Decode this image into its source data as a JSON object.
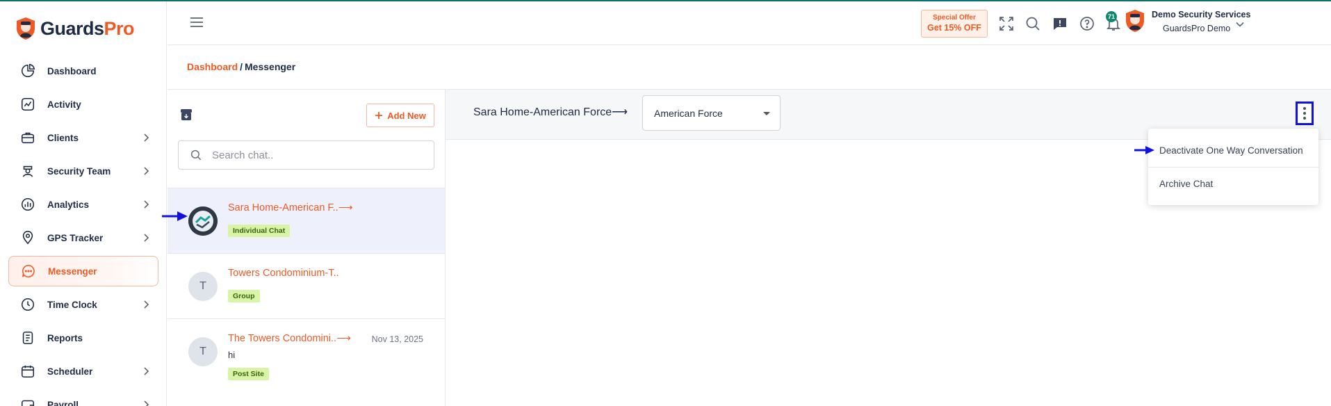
{
  "brand": {
    "name_part1": "Guards",
    "name_part2": "Pro"
  },
  "sidebar": {
    "items": [
      {
        "label": "Dashboard",
        "icon": "pie-chart-icon",
        "chevron": false,
        "active": false
      },
      {
        "label": "Activity",
        "icon": "activity-chart-icon",
        "chevron": false,
        "active": false
      },
      {
        "label": "Clients",
        "icon": "briefcase-icon",
        "chevron": true,
        "active": false
      },
      {
        "label": "Security Team",
        "icon": "guard-icon",
        "chevron": true,
        "active": false
      },
      {
        "label": "Analytics",
        "icon": "analytics-icon",
        "chevron": true,
        "active": false
      },
      {
        "label": "GPS Tracker",
        "icon": "location-pin-icon",
        "chevron": true,
        "active": false
      },
      {
        "label": "Messenger",
        "icon": "chat-bubble-icon",
        "chevron": false,
        "active": true
      },
      {
        "label": "Time Clock",
        "icon": "clock-icon",
        "chevron": true,
        "active": false
      },
      {
        "label": "Reports",
        "icon": "document-icon",
        "chevron": false,
        "active": false
      },
      {
        "label": "Scheduler",
        "icon": "calendar-icon",
        "chevron": true,
        "active": false
      },
      {
        "label": "Payroll",
        "icon": "wallet-icon",
        "chevron": true,
        "active": false
      }
    ]
  },
  "header": {
    "offer_line1": "Special Offer",
    "offer_line2": "Get 15% OFF",
    "notification_count": "71",
    "user_name": "Demo Security Services",
    "user_org": "GuardsPro Demo"
  },
  "breadcrumb": {
    "link": "Dashboard",
    "separator": "/",
    "current": "Messenger"
  },
  "chatlist": {
    "add_new_label": "Add New",
    "search_placeholder": "Search chat..",
    "chats": [
      {
        "name": "Sara Home-American F..⟶",
        "date": "",
        "message": "",
        "tag": "Individual Chat",
        "avatar_initial": "",
        "selected": true
      },
      {
        "name": "Towers Condominium-T..",
        "date": "",
        "message": "",
        "tag": "Group",
        "avatar_initial": "T",
        "selected": false
      },
      {
        "name": "The Towers Condomini..⟶",
        "date": "Nov 13, 2025",
        "message": "hi",
        "tag": "Post Site",
        "avatar_initial": "T",
        "selected": false
      }
    ]
  },
  "conversation": {
    "title": "Sara Home-American Force⟶",
    "select_value": "American Force"
  },
  "menu": {
    "items": [
      "Deactivate One Way Conversation",
      "Archive Chat"
    ]
  },
  "colors": {
    "accent": "#ef5a24",
    "annotation": "#1212e0",
    "tag_bg": "#d8f5a6",
    "selected_row": "#eef1fb"
  }
}
